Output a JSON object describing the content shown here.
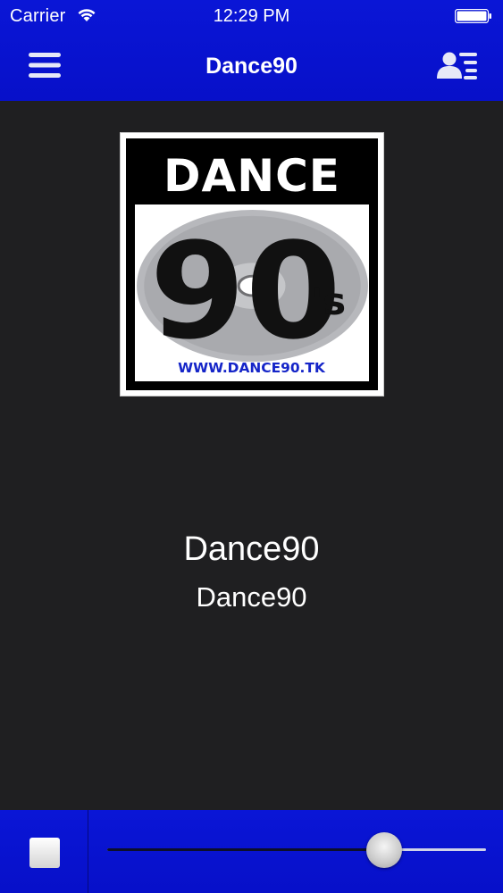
{
  "status_bar": {
    "carrier": "Carrier",
    "time": "12:29 PM",
    "battery_level": 1.0
  },
  "nav": {
    "title": "Dance90",
    "left_icon": "menu-icon",
    "right_icon": "contacts-list-icon"
  },
  "cover": {
    "band_text": "DANCE",
    "art_main": "90",
    "art_suffix": "'s",
    "art_url_text": "WWW.DANCE90.TK"
  },
  "now_playing": {
    "title": "Dance90",
    "subtitle": "Dance90"
  },
  "player": {
    "stop_icon": "stop-icon",
    "volume": 0.73
  },
  "colors": {
    "bar_blue": "#0a16d6",
    "background": "#1f1f21",
    "text": "#ffffff"
  }
}
